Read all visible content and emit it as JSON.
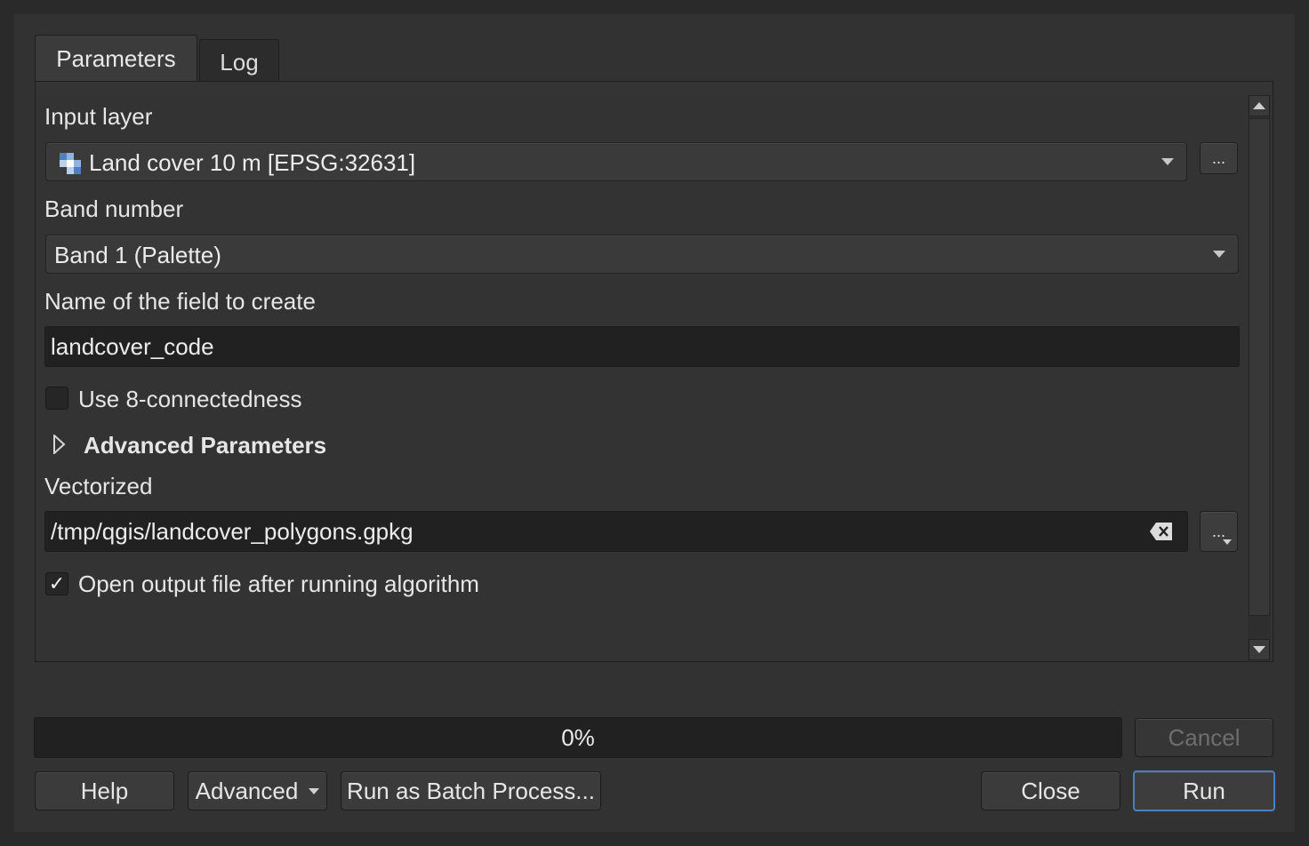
{
  "tabs": [
    {
      "label": "Parameters",
      "active": true
    },
    {
      "label": "Log",
      "active": false
    }
  ],
  "params": {
    "input_layer_label": "Input layer",
    "input_layer_value": "Land cover 10 m [EPSG:32631]",
    "input_layer_browse": "...",
    "band_label": "Band number",
    "band_value": "Band 1 (Palette)",
    "field_label": "Name of the field to create",
    "field_value": "landcover_code",
    "connectedness_label": "Use 8-connectedness",
    "connectedness_checked": false,
    "advanced_label": "Advanced Parameters",
    "vectorized_label": "Vectorized",
    "vectorized_value": "/tmp/qgis/landcover_polygons.gpkg",
    "vectorized_browse": "...",
    "open_output_label": "Open output file after running algorithm",
    "open_output_checked": true,
    "check_mark": "✓"
  },
  "progress": {
    "text": "0%",
    "value": 0
  },
  "buttons": {
    "cancel": "Cancel",
    "help": "Help",
    "advanced": "Advanced",
    "batch": "Run as Batch Process...",
    "close": "Close",
    "run": "Run"
  },
  "icons": {
    "layer": "raster-layer-icon",
    "clear": "clear-input-icon",
    "expand": "expand-triangle-icon"
  },
  "colors": {
    "default_button_border": "#4a7fc0",
    "background": "#323232"
  }
}
